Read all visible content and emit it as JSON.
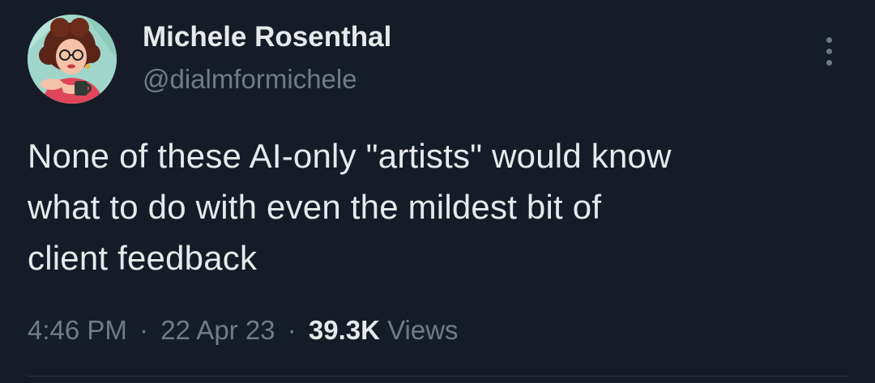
{
  "author": {
    "display_name": "Michele Rosenthal",
    "handle": "@dialmformichele"
  },
  "tweet": {
    "text": "None of these AI-only \"artists\" would know\nwhat to do with even the mildest bit of\nclient feedback",
    "time": "4:46 PM",
    "separator": "·",
    "date": "22 Apr 23",
    "views_count": "39.3K",
    "views_label": "Views"
  },
  "icons": {
    "more": "more-options-icon",
    "avatar": "avatar-illustration"
  },
  "colors": {
    "background": "#151c27",
    "primary_text": "#e7e9ea",
    "secondary_text": "#717b86"
  }
}
